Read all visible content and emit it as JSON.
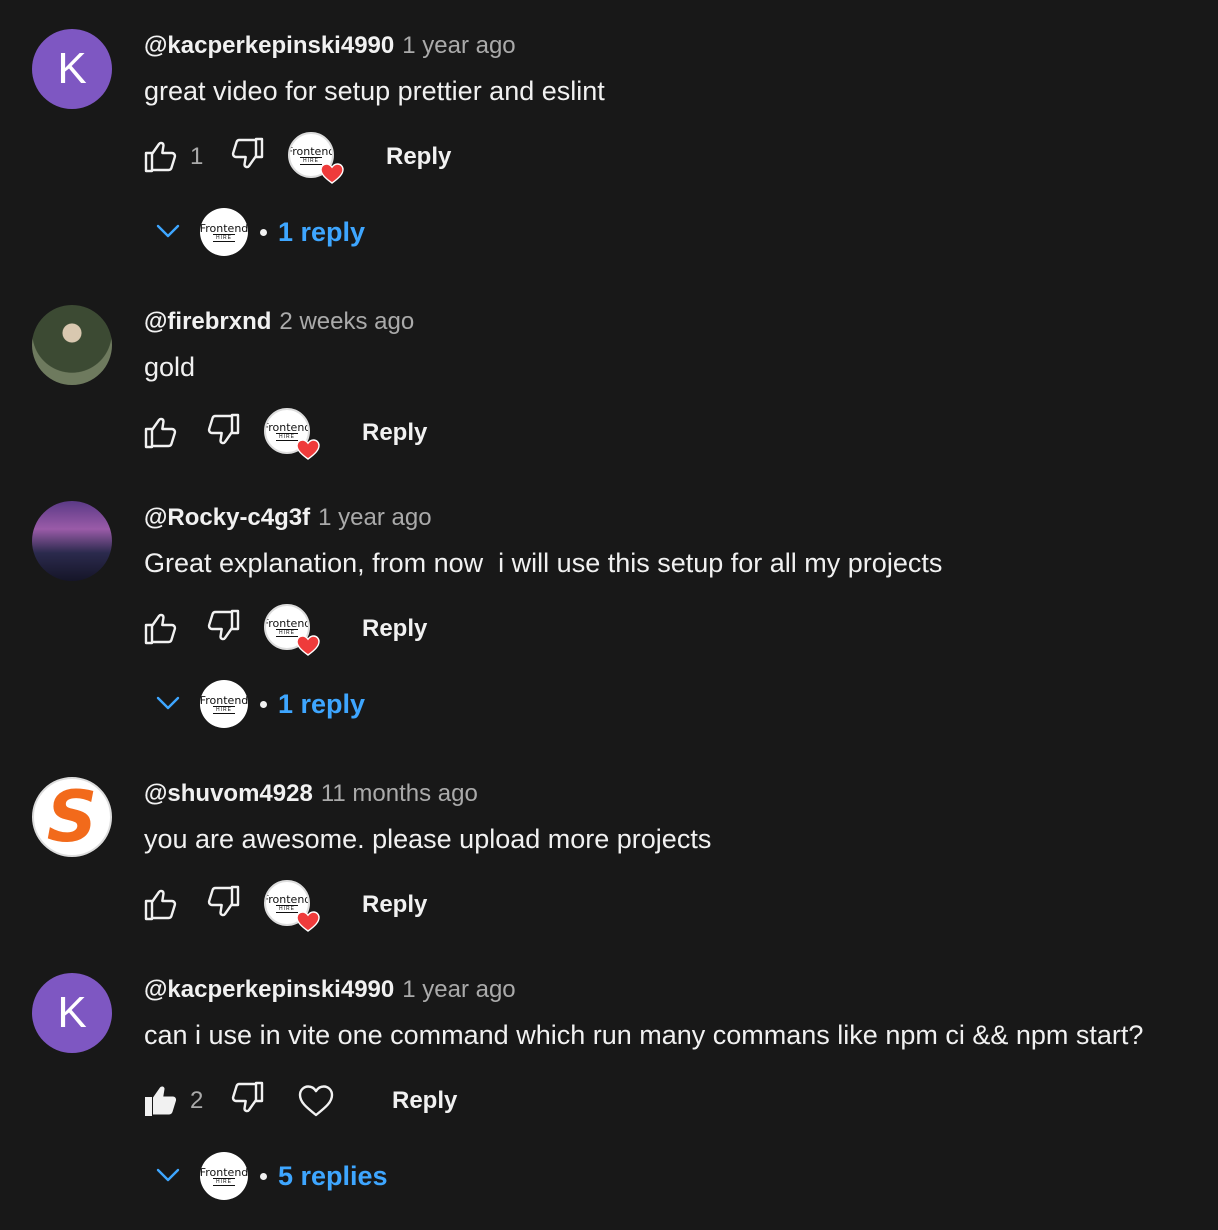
{
  "accent_link_color": "#3ea6ff",
  "heart_color": "#ef3b3b",
  "comments": [
    {
      "author": "@kacperkepinski4990",
      "time": "1 year ago",
      "avatar_letter": "K",
      "text": "great video for setup prettier and eslint",
      "likes": "1",
      "reply_label": "Reply",
      "replies_label": "1 reply",
      "creator_logo_top": "Frontend",
      "creator_logo_bottom": "HIRE"
    },
    {
      "author": "@firebrxnd",
      "time": "2 weeks ago",
      "text": "gold",
      "likes": "",
      "reply_label": "Reply",
      "creator_logo_top": "Frontend",
      "creator_logo_bottom": "HIRE"
    },
    {
      "author": "@Rocky-c4g3f",
      "time": "1 year ago",
      "text": "Great explanation, from now  i will use this setup for all my projects",
      "likes": "",
      "reply_label": "Reply",
      "replies_label": "1 reply",
      "creator_logo_top": "Frontend",
      "creator_logo_bottom": "HIRE"
    },
    {
      "author": "@shuvom4928",
      "time": "11 months ago",
      "avatar_letter": "S",
      "text": "you are awesome. please upload more projects",
      "likes": "",
      "reply_label": "Reply",
      "creator_logo_top": "Frontend",
      "creator_logo_bottom": "HIRE"
    },
    {
      "author": "@kacperkepinski4990",
      "time": "1 year ago",
      "avatar_letter": "K",
      "text": "can i use in vite one command which run many commans like npm ci && npm start?",
      "likes": "2",
      "reply_label": "Reply",
      "replies_label": "5 replies",
      "creator_logo_top": "Frontend",
      "creator_logo_bottom": "HIRE"
    }
  ]
}
